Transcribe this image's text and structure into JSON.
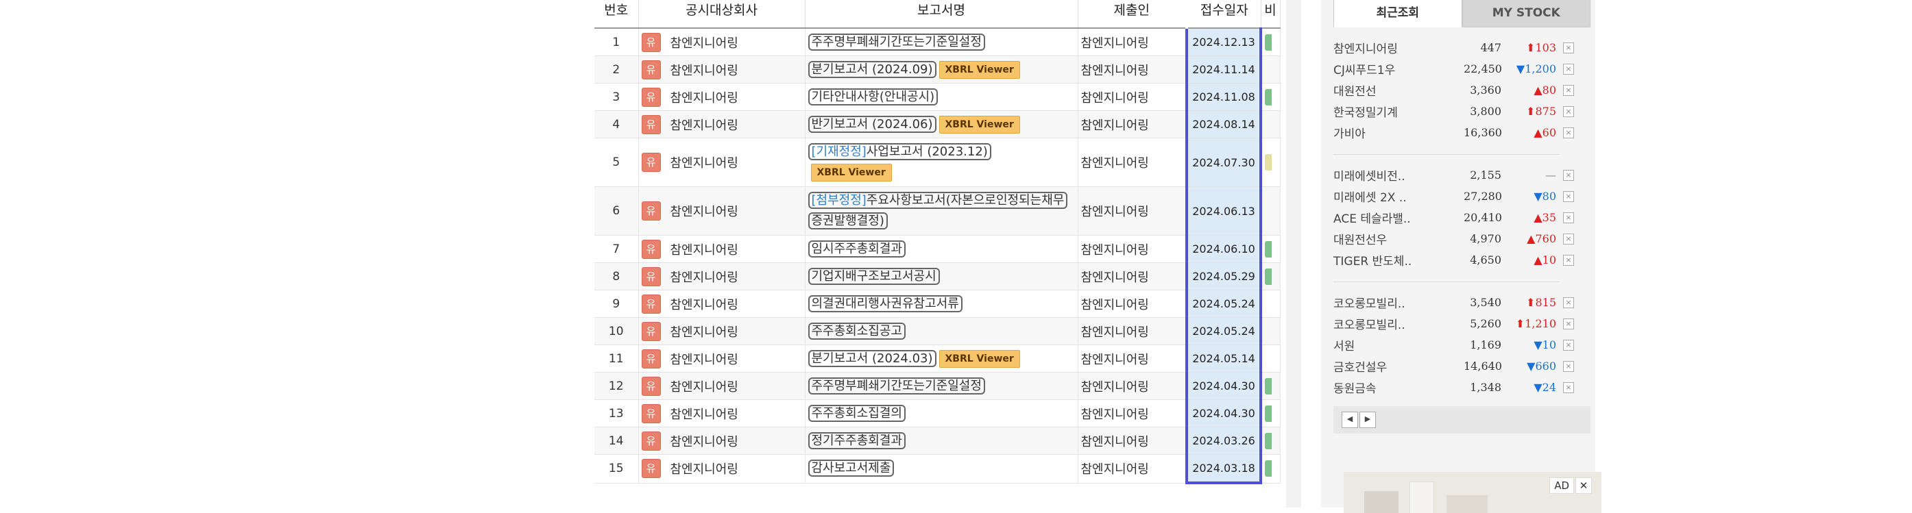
{
  "table": {
    "headers": {
      "no": "번호",
      "company": "공시대상회사",
      "report": "보고서명",
      "submitter": "제출인",
      "date": "접수일자",
      "remark": "비"
    },
    "rows": [
      {
        "no": "1",
        "badge": "유",
        "company": "참엔지니어링",
        "tag": "",
        "report": "주주명부폐쇄기간또는기준일설정",
        "xbrl": "",
        "submitter": "참엔지니어링",
        "date": "2024.12.13",
        "remark": "green"
      },
      {
        "no": "2",
        "badge": "유",
        "company": "참엔지니어링",
        "tag": "",
        "report": "분기보고서 (2024.09)",
        "xbrl": "XBRL Viewer",
        "submitter": "참엔지니어링",
        "date": "2024.11.14",
        "remark": ""
      },
      {
        "no": "3",
        "badge": "유",
        "company": "참엔지니어링",
        "tag": "",
        "report": "기타안내사항(안내공시)",
        "xbrl": "",
        "submitter": "참엔지니어링",
        "date": "2024.11.08",
        "remark": "green"
      },
      {
        "no": "4",
        "badge": "유",
        "company": "참엔지니어링",
        "tag": "",
        "report": "반기보고서 (2024.06)",
        "xbrl": "XBRL Viewer",
        "submitter": "참엔지니어링",
        "date": "2024.08.14",
        "remark": ""
      },
      {
        "no": "5",
        "badge": "유",
        "company": "참엔지니어링",
        "tag": "[기재정정]",
        "report": "사업보고서 (2023.12)",
        "xbrl": "XBRL Viewer",
        "submitter": "참엔지니어링",
        "date": "2024.07.30",
        "remark": "yellow"
      },
      {
        "no": "6",
        "badge": "유",
        "company": "참엔지니어링",
        "tag": "[첨부정정]",
        "report": "주요사항보고서(자본으로인정되는채무증권발행결정)",
        "xbrl": "",
        "submitter": "참엔지니어링",
        "date": "2024.06.13",
        "remark": ""
      },
      {
        "no": "7",
        "badge": "유",
        "company": "참엔지니어링",
        "tag": "",
        "report": "임시주주총회결과",
        "xbrl": "",
        "submitter": "참엔지니어링",
        "date": "2024.06.10",
        "remark": "green"
      },
      {
        "no": "8",
        "badge": "유",
        "company": "참엔지니어링",
        "tag": "",
        "report": "기업지배구조보고서공시",
        "xbrl": "",
        "submitter": "참엔지니어링",
        "date": "2024.05.29",
        "remark": "green"
      },
      {
        "no": "9",
        "badge": "유",
        "company": "참엔지니어링",
        "tag": "",
        "report": "의결권대리행사권유참고서류",
        "xbrl": "",
        "submitter": "참엔지니어링",
        "date": "2024.05.24",
        "remark": ""
      },
      {
        "no": "10",
        "badge": "유",
        "company": "참엔지니어링",
        "tag": "",
        "report": "주주총회소집공고",
        "xbrl": "",
        "submitter": "참엔지니어링",
        "date": "2024.05.24",
        "remark": ""
      },
      {
        "no": "11",
        "badge": "유",
        "company": "참엔지니어링",
        "tag": "",
        "report": "분기보고서 (2024.03)",
        "xbrl": "XBRL Viewer",
        "submitter": "참엔지니어링",
        "date": "2024.05.14",
        "remark": ""
      },
      {
        "no": "12",
        "badge": "유",
        "company": "참엔지니어링",
        "tag": "",
        "report": "주주명부폐쇄기간또는기준일설정",
        "xbrl": "",
        "submitter": "참엔지니어링",
        "date": "2024.04.30",
        "remark": "green"
      },
      {
        "no": "13",
        "badge": "유",
        "company": "참엔지니어링",
        "tag": "",
        "report": "주주총회소집결의",
        "xbrl": "",
        "submitter": "참엔지니어링",
        "date": "2024.04.30",
        "remark": "green"
      },
      {
        "no": "14",
        "badge": "유",
        "company": "참엔지니어링",
        "tag": "",
        "report": "정기주주총회결과",
        "xbrl": "",
        "submitter": "참엔지니어링",
        "date": "2024.03.26",
        "remark": "green"
      },
      {
        "no": "15",
        "badge": "유",
        "company": "참엔지니어링",
        "tag": "",
        "report": "감사보고서제출",
        "xbrl": "",
        "submitter": "참엔지니어링",
        "date": "2024.03.18",
        "remark": "green"
      }
    ]
  },
  "panel": {
    "tabs": [
      "최근조회",
      "MY STOCK"
    ],
    "groups": [
      [
        {
          "name": "참엔지니어링",
          "price": "447",
          "dir": "upbig",
          "arrow": "⬆",
          "change": "103"
        },
        {
          "name": "CJ씨푸드1우",
          "price": "22,450",
          "dir": "down",
          "arrow": "▼",
          "change": "1,200"
        },
        {
          "name": "대원전선",
          "price": "3,360",
          "dir": "up",
          "arrow": "▲",
          "change": "80"
        },
        {
          "name": "한국정밀기계",
          "price": "3,800",
          "dir": "upbig",
          "arrow": "⬆",
          "change": "875"
        },
        {
          "name": "가비아",
          "price": "16,360",
          "dir": "up",
          "arrow": "▲",
          "change": "60"
        }
      ],
      [
        {
          "name": "미래에셋비전..",
          "price": "2,155",
          "dir": "flat",
          "arrow": "",
          "change": "—"
        },
        {
          "name": "미래에셋 2X ..",
          "price": "27,280",
          "dir": "down",
          "arrow": "▼",
          "change": "80"
        },
        {
          "name": "ACE 테슬라밸..",
          "price": "20,410",
          "dir": "up",
          "arrow": "▲",
          "change": "35"
        },
        {
          "name": "대원전선우",
          "price": "4,970",
          "dir": "up",
          "arrow": "▲",
          "change": "760"
        },
        {
          "name": "TIGER 반도체..",
          "price": "4,650",
          "dir": "up",
          "arrow": "▲",
          "change": "10"
        }
      ],
      [
        {
          "name": "코오롱모빌리..",
          "price": "3,540",
          "dir": "upbig",
          "arrow": "⬆",
          "change": "815"
        },
        {
          "name": "코오롱모빌리..",
          "price": "5,260",
          "dir": "upbig",
          "arrow": "⬆",
          "change": "1,210"
        },
        {
          "name": "서원",
          "price": "1,169",
          "dir": "down",
          "arrow": "▼",
          "change": "10"
        },
        {
          "name": "금호건설우",
          "price": "14,640",
          "dir": "down",
          "arrow": "▼",
          "change": "660"
        },
        {
          "name": "동원금속",
          "price": "1,348",
          "dir": "down",
          "arrow": "▼",
          "change": "24"
        }
      ]
    ],
    "remove_icon": "×",
    "pager": {
      "prev": "◀",
      "next": "▶"
    }
  },
  "ad": {
    "label": "AD",
    "close": "✕"
  },
  "colors": {
    "accent": "#4f4fd8",
    "badge": "#e9806b",
    "xbrl": "#f8c46a",
    "up": "#e02020",
    "down": "#1a6fd8"
  }
}
